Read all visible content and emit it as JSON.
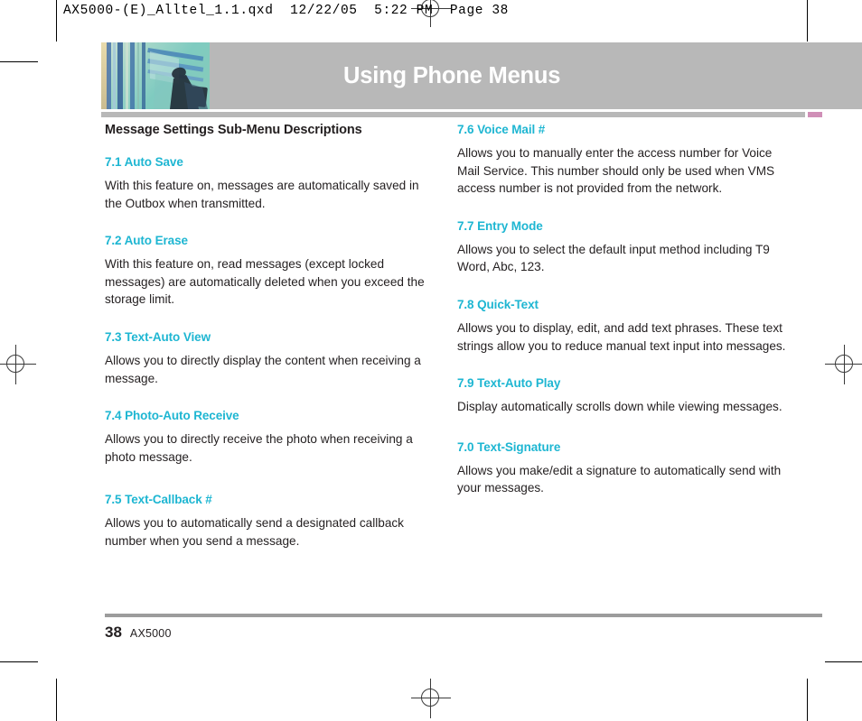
{
  "prepress": {
    "slug": "AX5000-(E)_Alltel_1.1.qxd  12/22/05  5:22 PM  Page 38",
    "registration_mark_icon": "registration-target-icon"
  },
  "header": {
    "title": "Using Phone Menus",
    "photo_alt": "abstract-blue-teal-photo",
    "bar_color": "#b8b8b8",
    "tab_color": "#d08fb7",
    "title_color": "#ffffff"
  },
  "colors": {
    "heading_teal": "#1eb6d2",
    "body_text": "#231f20",
    "rule_gray": "#9c9c9c"
  },
  "left_column": {
    "section_title": "Message Settings Sub-Menu Descriptions",
    "entries": [
      {
        "heading": "7.1 Auto Save",
        "body": "With this feature on, messages are automatically saved in the Outbox when transmitted."
      },
      {
        "heading": "7.2 Auto Erase",
        "body": "With this feature on, read messages (except locked messages) are automatically deleted when you exceed the storage limit."
      },
      {
        "heading": "7.3 Text-Auto View",
        "body": "Allows you to directly display the content when receiving a message."
      },
      {
        "heading": "7.4 Photo-Auto Receive",
        "body": "Allows you to directly receive the photo when receiving a photo message."
      },
      {
        "heading": "7.5 Text-Callback #",
        "body": "Allows you to automatically send a designated callback number when you send a message."
      }
    ]
  },
  "right_column": {
    "entries": [
      {
        "heading": "7.6 Voice Mail #",
        "body": "Allows you to manually enter the access number for Voice Mail Service. This number should only  be used when VMS access number is not provided from the network."
      },
      {
        "heading": "7.7 Entry Mode",
        "body": "Allows you to select the default input method including T9 Word, Abc, 123."
      },
      {
        "heading": "7.8 Quick-Text",
        "body": "Allows you to display, edit, and add text phrases. These text strings allow you to reduce manual text input into messages."
      },
      {
        "heading": "7.9 Text-Auto Play",
        "body": "Display automatically scrolls down while viewing messages."
      },
      {
        "heading": "7.0 Text-Signature",
        "body": "Allows you make/edit a signature to automatically send with your messages."
      }
    ]
  },
  "footer": {
    "page_number": "38",
    "model": "AX5000"
  }
}
